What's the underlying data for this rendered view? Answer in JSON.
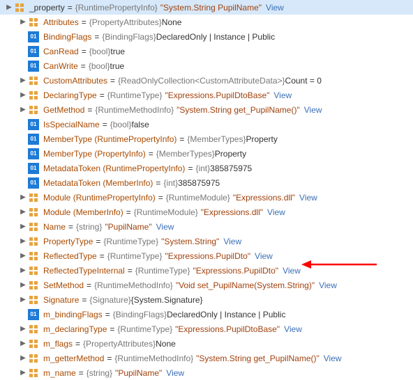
{
  "header": {
    "name": "_property",
    "typeVal": "{RuntimePropertyInfo}",
    "strVal": "\"System.String PupilName\"",
    "view": "View"
  },
  "rows": [
    {
      "expand": "tri",
      "icon": "group",
      "name": "Attributes",
      "gray": "{PropertyAttributes}",
      "tail": " None"
    },
    {
      "expand": "none",
      "icon": "blue",
      "name": "BindingFlags",
      "gray": "{BindingFlags}",
      "tail": " DeclaredOnly | Instance | Public"
    },
    {
      "expand": "none",
      "icon": "blue",
      "name": "CanRead",
      "gray": "{bool}",
      "tail": " true"
    },
    {
      "expand": "none",
      "icon": "blue",
      "name": "CanWrite",
      "gray": "{bool}",
      "tail": " true"
    },
    {
      "expand": "tri",
      "icon": "group",
      "name": "CustomAttributes",
      "gray": "{ReadOnlyCollection<CustomAttributeData>}",
      "tail": " Count = 0"
    },
    {
      "expand": "tri",
      "icon": "group",
      "name": "DeclaringType",
      "gray": "{RuntimeType}",
      "str": "\"Expressions.PupilDtoBase\"",
      "view": "View"
    },
    {
      "expand": "tri",
      "icon": "group",
      "name": "GetMethod",
      "gray": "{RuntimeMethodInfo}",
      "str": "\"System.String get_PupilName()\"",
      "view": "View"
    },
    {
      "expand": "none",
      "icon": "blue",
      "name": "IsSpecialName",
      "gray": "{bool}",
      "tail": " false"
    },
    {
      "expand": "none",
      "icon": "blue",
      "name": "MemberType (RuntimePropertyInfo)",
      "gray": "{MemberTypes}",
      "tail": " Property"
    },
    {
      "expand": "none",
      "icon": "blue",
      "name": "MemberType (PropertyInfo)",
      "gray": "{MemberTypes}",
      "tail": " Property"
    },
    {
      "expand": "none",
      "icon": "blue",
      "name": "MetadataToken (RuntimePropertyInfo)",
      "gray": "{int}",
      "tail": " 385875975"
    },
    {
      "expand": "none",
      "icon": "blue",
      "name": "MetadataToken (MemberInfo)",
      "gray": "{int}",
      "tail": " 385875975"
    },
    {
      "expand": "tri",
      "icon": "group",
      "name": "Module (RuntimePropertyInfo)",
      "gray": "{RuntimeModule}",
      "str": "\"Expressions.dll\"",
      "view": "View"
    },
    {
      "expand": "tri",
      "icon": "group",
      "name": "Module (MemberInfo)",
      "gray": "{RuntimeModule}",
      "str": "\"Expressions.dll\"",
      "view": "View"
    },
    {
      "expand": "tri",
      "icon": "group",
      "name": "Name",
      "gray": "{string}",
      "str": "\"PupilName\"",
      "view": "View"
    },
    {
      "expand": "tri",
      "icon": "group",
      "name": "PropertyType",
      "gray": "{RuntimeType}",
      "str": "\"System.String\"",
      "view": "View"
    },
    {
      "expand": "tri",
      "icon": "group",
      "name": "ReflectedType",
      "gray": "{RuntimeType}",
      "str": "\"Expressions.PupilDto\"",
      "view": "View"
    },
    {
      "expand": "tri",
      "icon": "group",
      "name": "ReflectedTypeInternal",
      "gray": "{RuntimeType}",
      "str": "\"Expressions.PupilDto\"",
      "view": "View"
    },
    {
      "expand": "tri",
      "icon": "group",
      "name": "SetMethod",
      "gray": "{RuntimeMethodInfo}",
      "str": "\"Void set_PupilName(System.String)\"",
      "view": "View"
    },
    {
      "expand": "tri",
      "icon": "group",
      "name": "Signature",
      "gray": "{Signature}",
      "tail": " {System.Signature}"
    },
    {
      "expand": "none",
      "icon": "blue",
      "name": "m_bindingFlags",
      "gray": "{BindingFlags}",
      "tail": " DeclaredOnly | Instance | Public"
    },
    {
      "expand": "tri",
      "icon": "group",
      "name": "m_declaringType",
      "gray": "{RuntimeType}",
      "str": "\"Expressions.PupilDtoBase\"",
      "view": "View"
    },
    {
      "expand": "tri",
      "icon": "group",
      "name": "m_flags",
      "gray": "{PropertyAttributes}",
      "tail": " None"
    },
    {
      "expand": "tri",
      "icon": "group",
      "name": "m_getterMethod",
      "gray": "{RuntimeMethodInfo}",
      "str": "\"System.String get_PupilName()\"",
      "view": "View"
    },
    {
      "expand": "tri",
      "icon": "group",
      "name": "m_name",
      "gray": "{string}",
      "str": "\"PupilName\"",
      "view": "View"
    }
  ],
  "view_label": "View"
}
